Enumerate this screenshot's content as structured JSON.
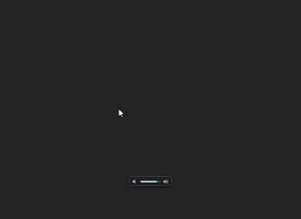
{
  "desktop": {
    "background_color": "#232323"
  },
  "cursor": {
    "icon": "arrow-pointer-icon"
  },
  "volume_control": {
    "min_icon": "speaker-low-icon",
    "max_icon": "speaker-high-icon",
    "level": 0.82,
    "fill_color": "#8ecfd6"
  }
}
